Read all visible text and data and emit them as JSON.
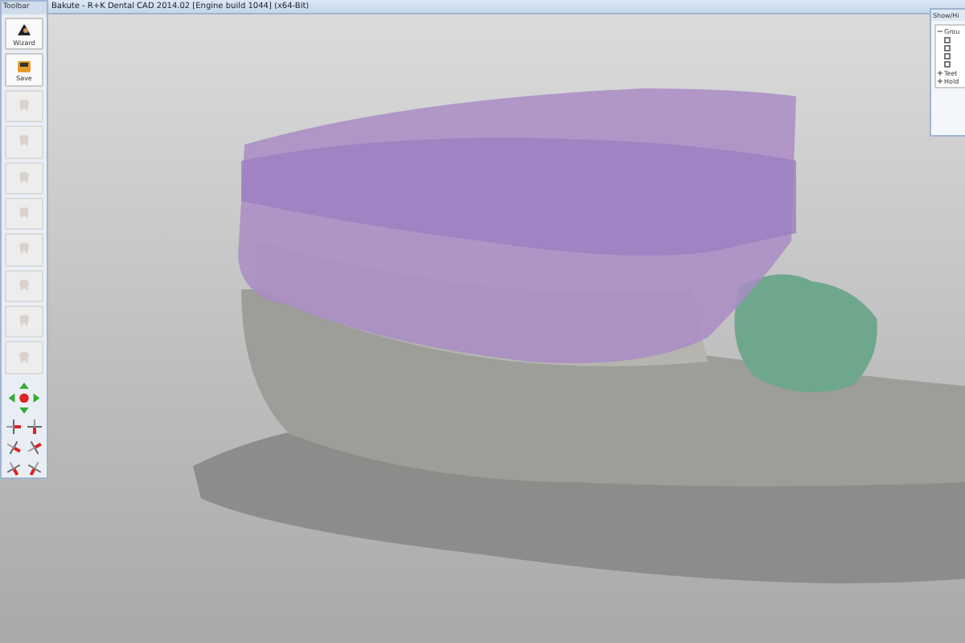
{
  "window": {
    "title": "Bakute - R+K Dental CAD 2014.02 [Engine build 1044] (x64-Bit)"
  },
  "toolbar": {
    "title": "Toolbar",
    "tools": [
      {
        "kind": "wizard",
        "label": "Wizard",
        "disabled": false
      },
      {
        "kind": "save",
        "label": "Save",
        "disabled": false
      },
      {
        "kind": "generic",
        "disabled": true
      },
      {
        "kind": "generic",
        "disabled": true
      },
      {
        "kind": "generic",
        "disabled": true
      },
      {
        "kind": "generic",
        "disabled": true
      },
      {
        "kind": "generic",
        "disabled": true
      },
      {
        "kind": "generic",
        "disabled": true
      },
      {
        "kind": "generic",
        "disabled": true
      },
      {
        "kind": "generic",
        "disabled": true
      }
    ]
  },
  "panel": {
    "title": "Show/Hi",
    "groups": [
      {
        "label": "Grou",
        "expanded": true,
        "items": [
          {
            "checked": false
          },
          {
            "checked": false
          },
          {
            "checked": false
          },
          {
            "checked": false
          }
        ]
      },
      {
        "label": "Teet",
        "expanded": false
      },
      {
        "label": "Hold",
        "expanded": false
      }
    ]
  }
}
